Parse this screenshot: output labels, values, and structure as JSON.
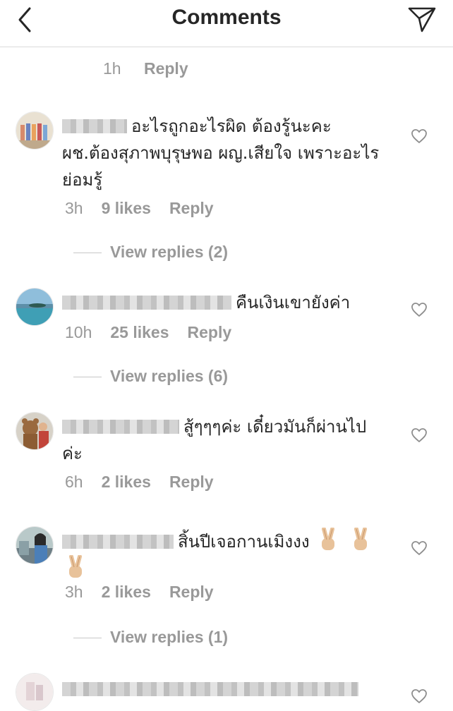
{
  "header": {
    "title": "Comments"
  },
  "top_meta": {
    "time": "1h",
    "reply": "Reply"
  },
  "comments": [
    {
      "text": "อะไรถูกอะไรผิด ต้องรู้นะคะ ผช.ต้องสุภาพบุรุษพอ ผญ.เสียใจ เพราะอะไร ย่อมรู้",
      "time": "3h",
      "likes": "9 likes",
      "reply": "Reply",
      "view_replies": "View replies (2)"
    },
    {
      "text": "คืนเงินเขายังค่า",
      "time": "10h",
      "likes": "25 likes",
      "reply": "Reply",
      "view_replies": "View replies (6)"
    },
    {
      "text": "สู้ๆๆๆค่ะ เดี๋ยวมันก็ผ่านไปค่ะ",
      "time": "6h",
      "likes": "2 likes",
      "reply": "Reply"
    },
    {
      "text": "สิ้นปีเจอกานเมิงงง",
      "time": "3h",
      "likes": "2 likes",
      "reply": "Reply",
      "view_replies": "View replies (1)"
    }
  ],
  "icons": {
    "back": "chevron-left-icon",
    "send": "paper-plane-icon",
    "like": "heart-outline-icon",
    "emoji": "victory-hand-emoji"
  },
  "colors": {
    "text": "#262626",
    "muted": "#999999",
    "divider": "#dbdbdb"
  }
}
